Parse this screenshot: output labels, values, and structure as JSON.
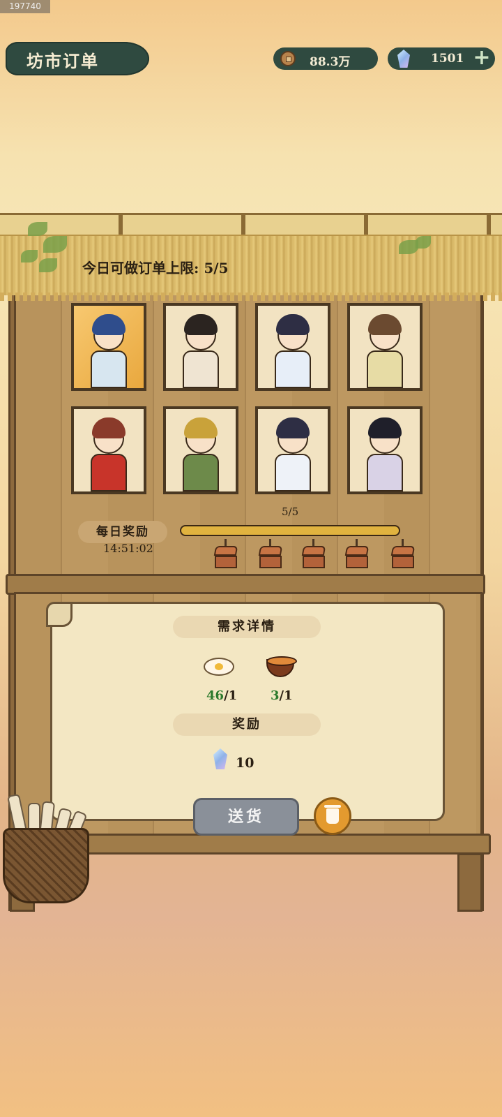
{
  "build_tag": "197740",
  "header": {
    "title": "坊市订单",
    "coins": "88.3万",
    "gems": "1501",
    "coin_icon": "copper-coin-icon",
    "gem_icon": "spirit-crystal-icon"
  },
  "stall": {
    "order_limit": "今日可做订单上限: 5/5",
    "characters": [
      {
        "name": "dragon-customer",
        "hair": "#2f4d8c",
        "body": "#d7e6f0"
      },
      {
        "name": "apprentice-customer",
        "hair": "#2b2420",
        "body": "#efe4d2"
      },
      {
        "name": "blue-ribbon-girl",
        "hair": "#2e2e44",
        "body": "#e7eef8"
      },
      {
        "name": "twin-bun-girl",
        "hair": "#6b4a30",
        "body": "#e7dca5"
      },
      {
        "name": "boar-customer",
        "hair": "#8a3a2a",
        "body": "#c8342a"
      },
      {
        "name": "veiled-merchant",
        "hair": "#c9a23a",
        "body": "#6d8a4a"
      },
      {
        "name": "blue-ribbon-disciple",
        "hair": "#2e2e44",
        "body": "#eef2f8"
      },
      {
        "name": "dark-hair-youth",
        "hair": "#1f1f2a",
        "body": "#d9d2e6"
      }
    ],
    "daily_reward_label": "每日奖励",
    "timer": "14:51:02",
    "progress_text": "5/5",
    "progress_fraction": 1.0,
    "chest_count": 5
  },
  "order": {
    "details_title": "需求详情",
    "items": [
      {
        "icon": "fried-egg-icon",
        "have": "46",
        "need": "/1"
      },
      {
        "icon": "soup-bowl-icon",
        "have": "3",
        "need": "/1"
      }
    ],
    "reward_title": "奖励",
    "reward_icon": "spirit-crystal-icon",
    "reward_amount": "10",
    "deliver_label": "送货",
    "discard_icon": "trash-icon"
  },
  "colors": {
    "banner": "#2f4a40",
    "progress": "#e1b33f",
    "have_green": "#2c7a2c",
    "deliver_gray": "#8a9099",
    "trash_orange": "#e39a2f"
  }
}
